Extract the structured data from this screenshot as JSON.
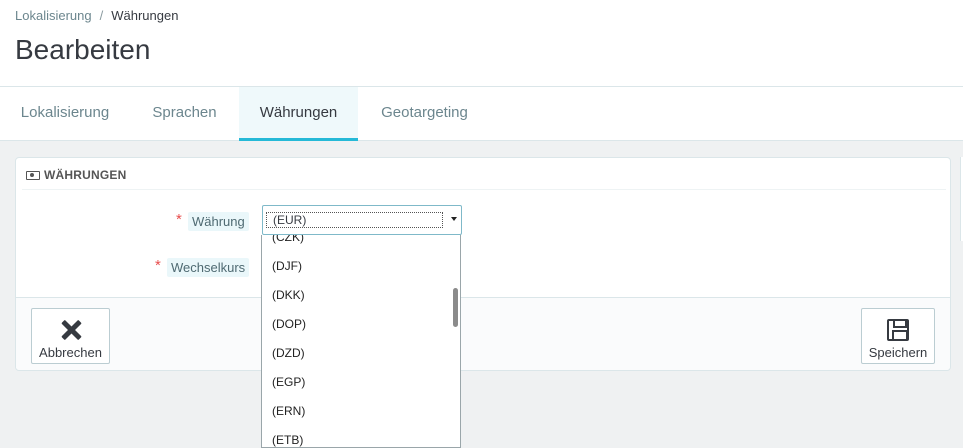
{
  "breadcrumb": {
    "parent": "Lokalisierung",
    "separator": "/",
    "current": "Währungen"
  },
  "page": {
    "title": "Bearbeiten"
  },
  "tabs": [
    {
      "label": "Lokalisierung"
    },
    {
      "label": "Sprachen"
    },
    {
      "label": "Währungen",
      "active": true
    },
    {
      "label": "Geotargeting"
    }
  ],
  "panel": {
    "heading": "WÄHRUNGEN",
    "heading_icon": "money-icon",
    "fields": {
      "currency": {
        "required_mark": "*",
        "label": "Währung",
        "value": "(EUR)"
      },
      "rate": {
        "required_mark": "*",
        "label": "Wechselkurs"
      }
    },
    "footer": {
      "cancel_label": "Abbrechen",
      "save_label": "Speichern"
    }
  },
  "dropdown": {
    "options": [
      "(CZK)",
      "(DJF)",
      "(DKK)",
      "(DOP)",
      "(DZD)",
      "(EGP)",
      "(ERN)",
      "(ETB)"
    ]
  },
  "colors": {
    "accent": "#25b9d7",
    "required": "#e84e4e"
  }
}
